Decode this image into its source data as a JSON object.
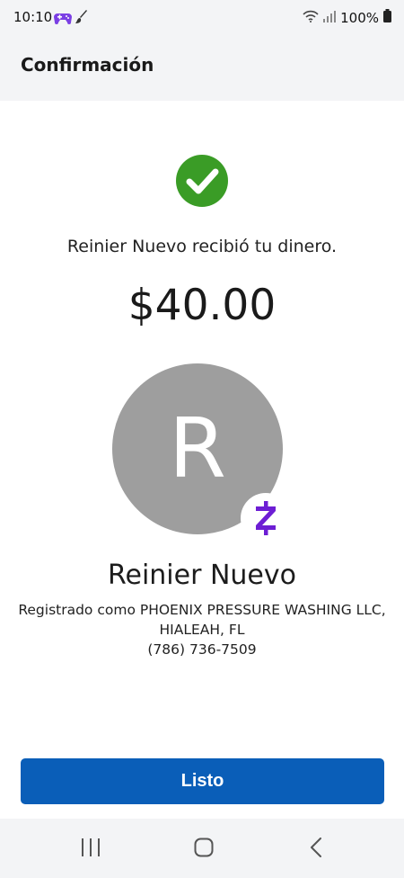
{
  "status_bar": {
    "time": "10:10",
    "battery": "100%",
    "left_icons": [
      "game-controller-icon",
      "brush-icon"
    ],
    "right_icons": [
      "wifi-icon",
      "signal-icon",
      "battery-icon"
    ]
  },
  "header": {
    "title": "Confirmación"
  },
  "confirmation": {
    "status_icon": "checkmark-icon",
    "message": "Reinier Nuevo recibió tu dinero.",
    "amount": "$40.00"
  },
  "recipient": {
    "avatar_letter": "R",
    "badge_icon": "zelle-icon",
    "name": "Reinier Nuevo",
    "registered_line1": "Registrado como PHOENIX PRESSURE WASHING LLC,",
    "registered_line2": "HIALEAH, FL",
    "phone": "(786) 736-7509"
  },
  "actions": {
    "done_label": "Listo"
  },
  "nav_bar": {
    "icons": [
      "recents-icon",
      "home-icon",
      "back-icon"
    ]
  },
  "colors": {
    "success_green": "#3a9c26",
    "button_blue": "#0a5eb8",
    "avatar_gray": "#9e9e9e",
    "zelle_purple": "#6d1ed4",
    "bar_background": "#f3f4f6"
  }
}
